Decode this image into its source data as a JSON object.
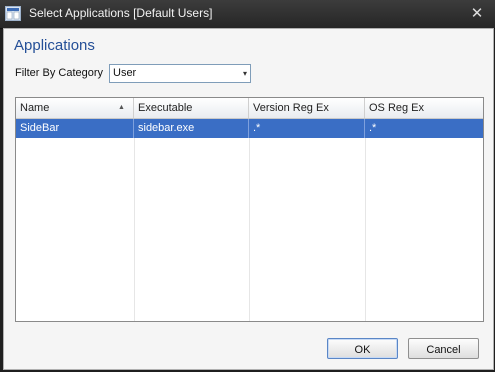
{
  "window": {
    "title": "Select Applications [Default Users]",
    "close_glyph": "✕",
    "icon": "app-window-icon"
  },
  "heading": "Applications",
  "filter": {
    "label": "Filter By Category",
    "selected": "User",
    "arrow_glyph": "▾"
  },
  "grid": {
    "columns": [
      {
        "label": "Name",
        "sort": "ascending"
      },
      {
        "label": "Executable"
      },
      {
        "label": "Version Reg Ex"
      },
      {
        "label": "OS Reg Ex"
      }
    ],
    "sort_glyph": "▲",
    "rows": [
      {
        "cells": [
          "SideBar",
          "sidebar.exe",
          ".*",
          ".*"
        ],
        "selected": true
      }
    ]
  },
  "buttons": {
    "ok": "OK",
    "cancel": "Cancel"
  },
  "colors": {
    "accent": "#244f97",
    "selection": "#3a6ec5",
    "titlebar": "#2b2b2b"
  }
}
